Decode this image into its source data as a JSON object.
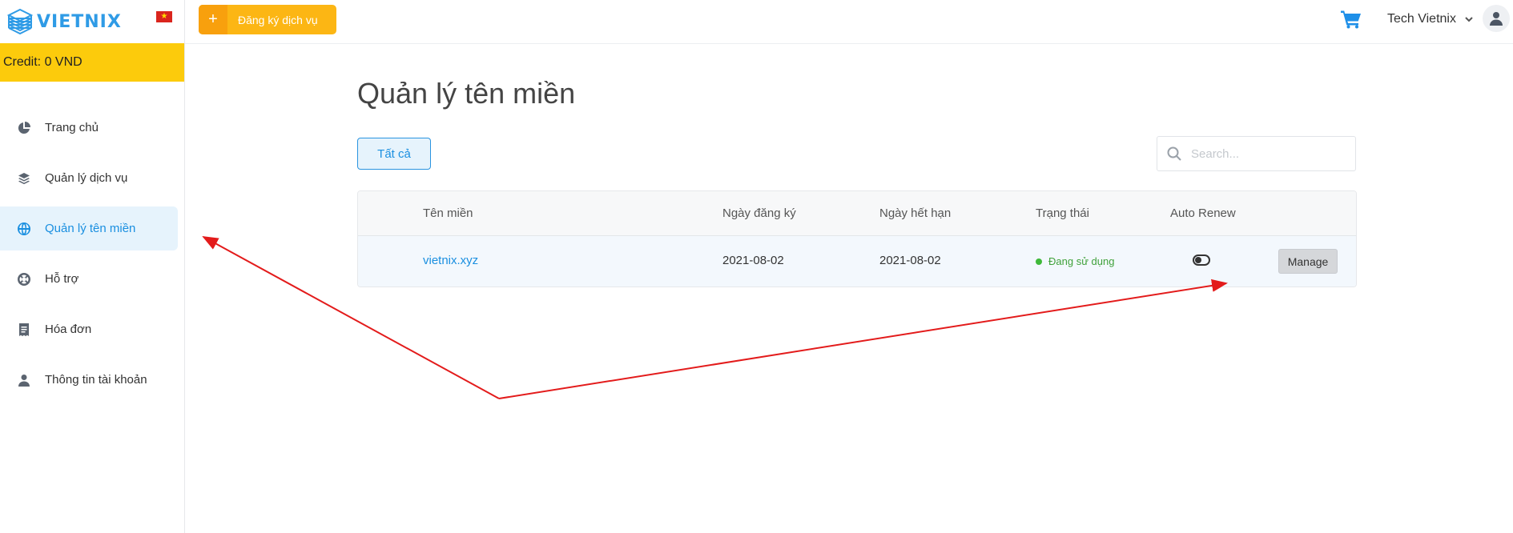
{
  "brand": {
    "name": "VIETNIX",
    "flag": "★"
  },
  "sidebar": {
    "credit": "Credit: 0 VND",
    "items": [
      {
        "label": "Trang chủ",
        "icon": "pie-chart-icon"
      },
      {
        "label": "Quản lý dịch vụ",
        "icon": "layers-icon"
      },
      {
        "label": "Quản lý tên miền",
        "icon": "globe-icon",
        "active": true
      },
      {
        "label": "Hỗ trợ",
        "icon": "lifebuoy-icon"
      },
      {
        "label": "Hóa đơn",
        "icon": "receipt-icon"
      },
      {
        "label": "Thông tin tài khoản",
        "icon": "user-icon"
      }
    ]
  },
  "topbar": {
    "register_plus": "+",
    "register_label": "Đăng ký dịch vụ",
    "user_name": "Tech Vietnix"
  },
  "main": {
    "title": "Quản lý tên miền",
    "filter_label": "Tất cả",
    "search_placeholder": "Search...",
    "table": {
      "headers": [
        "Tên miền",
        "Ngày đăng ký",
        "Ngày hết hạn",
        "Trạng thái",
        "Auto Renew"
      ],
      "rows": [
        {
          "domain": "vietnix.xyz",
          "registered": "2021-08-02",
          "expires": "2021-08-02",
          "status": "Đang sử dụng",
          "auto_renew": false,
          "action": "Manage"
        }
      ]
    }
  },
  "colors": {
    "accent": "#1a8fe0",
    "credit_bg": "#fccb0c",
    "register_bg": "#fcb614",
    "status_green": "#3fb93a",
    "annotation": "#e31b1b"
  }
}
